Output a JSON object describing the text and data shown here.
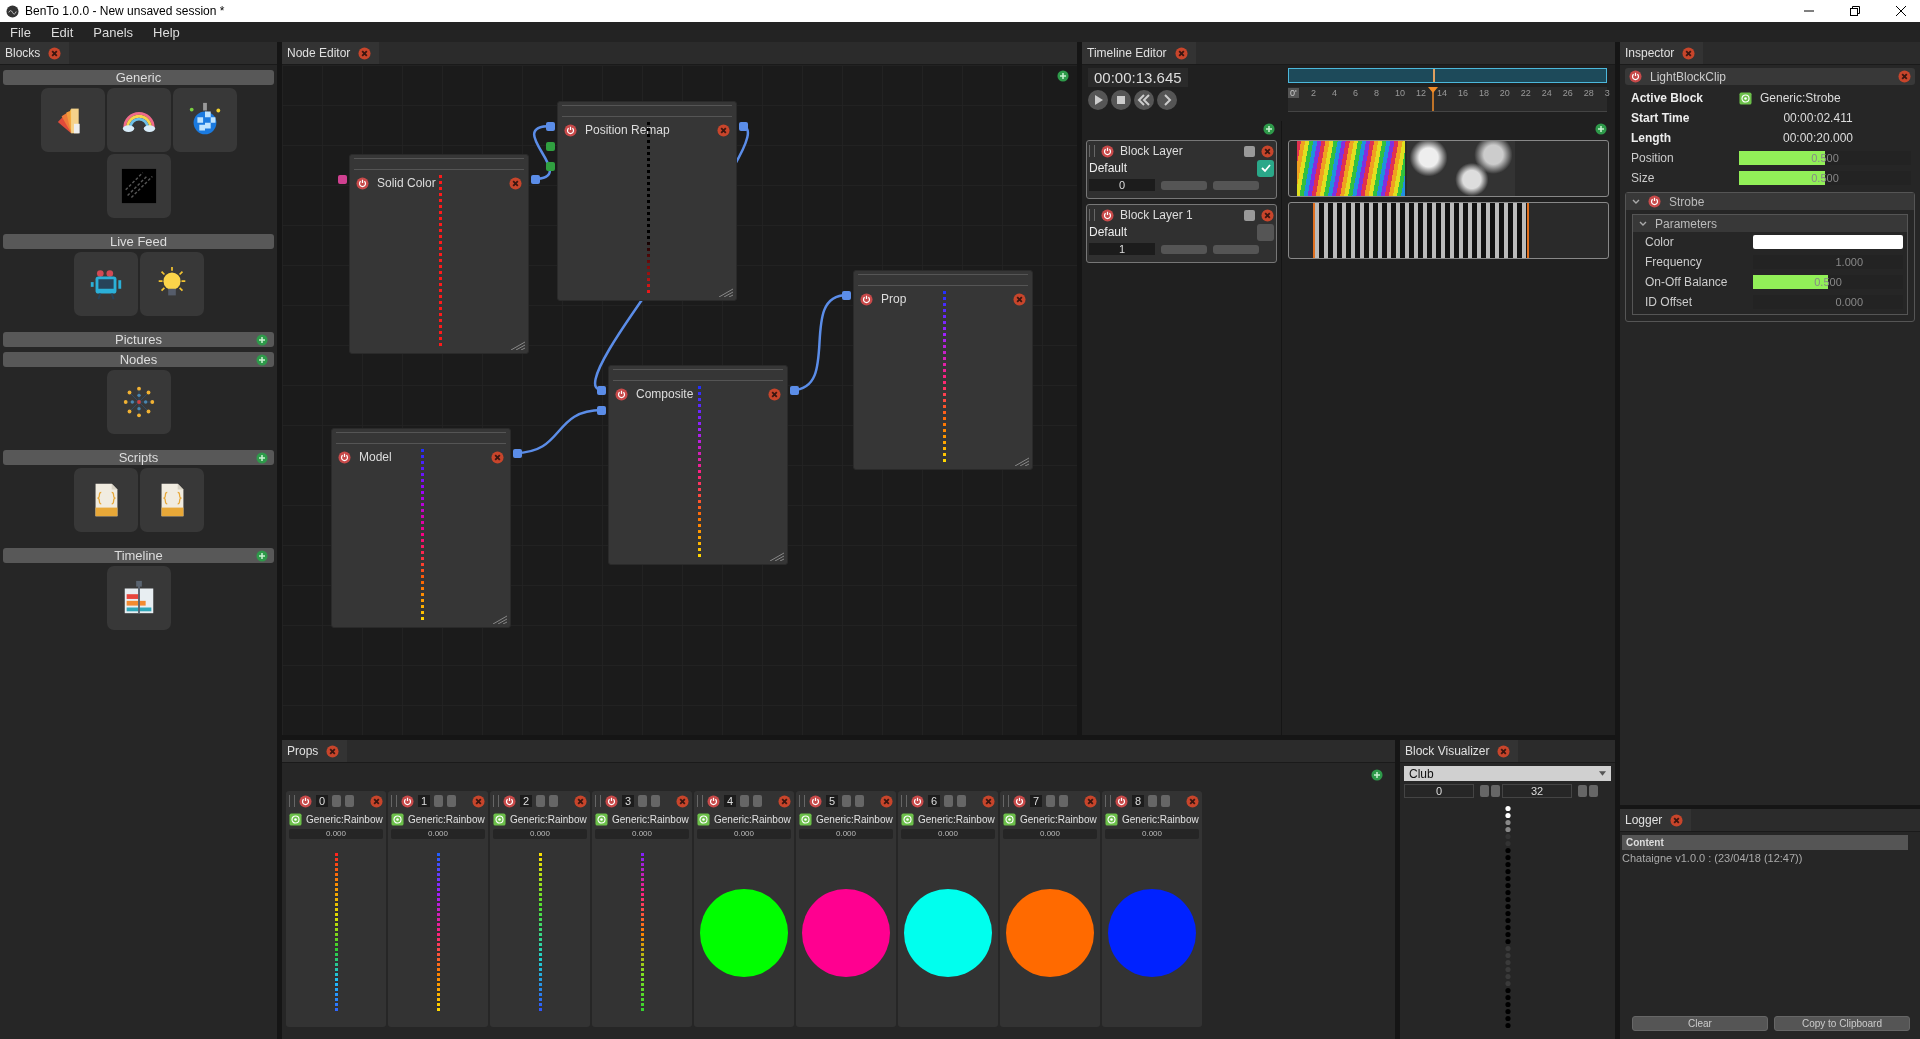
{
  "window": {
    "title": "BenTo 1.0.0 - New unsaved session *"
  },
  "menu": [
    "File",
    "Edit",
    "Panels",
    "Help"
  ],
  "blocks_panel": {
    "tab": "Blocks",
    "sections": [
      {
        "title": "Generic",
        "addable": false,
        "tiles": [
          {
            "kind": "swatches"
          },
          {
            "kind": "rainbow"
          },
          {
            "kind": "disco-ball"
          },
          {
            "kind": "noise"
          }
        ]
      },
      {
        "title": "Live Feed",
        "addable": false,
        "tiles": [
          {
            "kind": "camera"
          },
          {
            "kind": "lightbulb"
          }
        ]
      },
      {
        "title": "Pictures",
        "addable": true
      },
      {
        "title": "Nodes",
        "addable": true,
        "tiles": [
          {
            "kind": "network"
          }
        ]
      },
      {
        "title": "Scripts",
        "addable": true,
        "tiles": [
          {
            "kind": "script"
          },
          {
            "kind": "script"
          }
        ]
      },
      {
        "title": "Timeline",
        "addable": true,
        "tiles": [
          {
            "kind": "timeline"
          }
        ]
      }
    ]
  },
  "node_editor": {
    "tab": "Node Editor",
    "nodes": [
      {
        "title": "Solid Color"
      },
      {
        "title": "Position Remap"
      },
      {
        "title": "Composite"
      },
      {
        "title": "Prop"
      },
      {
        "title": "Model"
      }
    ]
  },
  "timeline": {
    "tab": "Timeline Editor",
    "time": "00:00:13.645",
    "ruler_labels": [
      "0'",
      "2",
      "4",
      "6",
      "8",
      "10",
      "12",
      "14",
      "16",
      "18",
      "20",
      "22",
      "24",
      "26",
      "28",
      "3"
    ],
    "playhead": {
      "level": 0.455
    },
    "layers": [
      {
        "name": "Block Layer",
        "mode": "Default",
        "number": "0",
        "enabled": true,
        "kind": "rainbow-noise"
      },
      {
        "name": "Block Layer 1",
        "mode": "Default",
        "number": "1",
        "enabled": false,
        "kind": "strobe"
      }
    ]
  },
  "inspector": {
    "tab": "Inspector",
    "title": "LightBlockClip",
    "fields": [
      {
        "kind": "block",
        "label": "Active Block",
        "value": "Generic:Strobe"
      },
      {
        "kind": "text",
        "label": "Start Time",
        "value": "00:00:02.411"
      },
      {
        "kind": "text",
        "label": "Length",
        "value": "00:00:20.000"
      },
      {
        "kind": "slider",
        "label": "Position",
        "value": "0.500",
        "level": 0.5
      },
      {
        "kind": "slider",
        "label": "Size",
        "value": "0.500",
        "level": 0.5
      }
    ],
    "section": {
      "title": "Strobe",
      "expanded": true,
      "group": {
        "title": "Parameters",
        "expanded": true,
        "fields": [
          {
            "kind": "color",
            "label": "Color",
            "color": "#ffffff"
          },
          {
            "kind": "number",
            "label": "Frequency",
            "value": "1.000"
          },
          {
            "kind": "slider",
            "label": "On-Off Balance",
            "value": "0.500",
            "level": 0.5
          },
          {
            "kind": "number",
            "label": "ID Offset",
            "value": "0.000"
          }
        ]
      }
    }
  },
  "props": {
    "tab": "Props",
    "items": [
      {
        "id": "0",
        "block": "Generic:Rainbow",
        "value": "0.000",
        "kind": "strip"
      },
      {
        "id": "1",
        "block": "Generic:Rainbow",
        "value": "0.000",
        "kind": "strip"
      },
      {
        "id": "2",
        "block": "Generic:Rainbow",
        "value": "0.000",
        "kind": "strip"
      },
      {
        "id": "3",
        "block": "Generic:Rainbow",
        "value": "0.000",
        "kind": "strip"
      },
      {
        "id": "4",
        "block": "Generic:Rainbow",
        "value": "0.000",
        "kind": "circle",
        "color": "#00ff00"
      },
      {
        "id": "5",
        "block": "Generic:Rainbow",
        "value": "0.000",
        "kind": "circle",
        "color": "#ff0090"
      },
      {
        "id": "6",
        "block": "Generic:Rainbow",
        "value": "0.000",
        "kind": "circle",
        "color": "#00ffee"
      },
      {
        "id": "7",
        "block": "Generic:Rainbow",
        "value": "0.000",
        "kind": "circle",
        "color": "#ff6a00"
      },
      {
        "id": "8",
        "block": "Generic:Rainbow",
        "value": "0.000",
        "kind": "circle",
        "color": "#0022ff"
      }
    ]
  },
  "visualizer": {
    "tab": "Block Visualizer",
    "prop": "Club",
    "start": "0",
    "count": "32"
  },
  "logger": {
    "tab": "Logger",
    "column": "Content",
    "entries": [
      "Chataigne v1.0.0 : (23/04/18 (12:47))"
    ],
    "buttons": [
      "Clear",
      "Copy to Clipboard"
    ]
  }
}
